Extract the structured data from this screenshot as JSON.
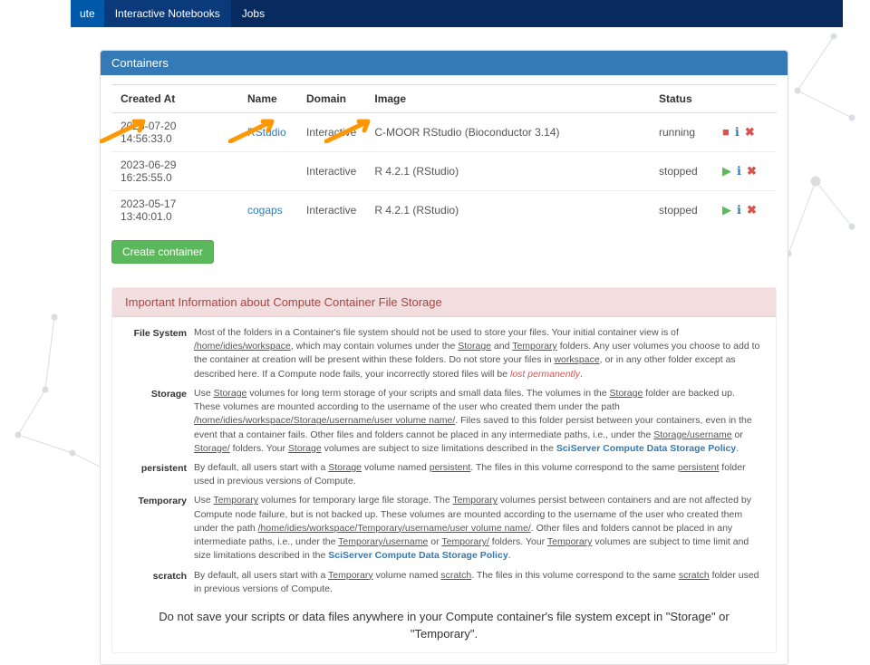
{
  "nav": {
    "brand": "ute",
    "items": [
      "Interactive Notebooks",
      "Jobs"
    ]
  },
  "panel": {
    "title": "Containers",
    "columns": [
      "Created At",
      "Name",
      "Domain",
      "Image",
      "Status",
      ""
    ],
    "rows": [
      {
        "created": "2023-07-20 14:56:33.0",
        "name": "RStudio",
        "domain": "Interactive",
        "image": "C-MOOR RStudio (Bioconductor 3.14)",
        "status": "running",
        "running": true
      },
      {
        "created": "2023-06-29 16:25:55.0",
        "name": "<None>",
        "domain": "Interactive",
        "image": "R 4.2.1 (RStudio)",
        "status": "stopped",
        "running": false
      },
      {
        "created": "2023-05-17 13:40:01.0",
        "name": "cogaps",
        "domain": "Interactive",
        "image": "R 4.2.1 (RStudio)",
        "status": "stopped",
        "running": false
      }
    ],
    "create_label": "Create container"
  },
  "info": {
    "heading": "Important Information about Compute Container File Storage",
    "filesystem_label": "File System",
    "filesystem_text_a": "Most of the folders in a Container's file system should not be used to store your files. Your initial container view is of ",
    "filesystem_path1": "/home/idies/workspace",
    "filesystem_text_b": ", which may contain volumes under the ",
    "filesystem_u1": "Storage",
    "filesystem_text_c": " and ",
    "filesystem_u2": "Temporary",
    "filesystem_text_d": " folders. Any user volumes you choose to add to the container at creation will be present within these folders. Do not store your files in ",
    "filesystem_u3": "workspace",
    "filesystem_text_e": ", or in any other folder except as described here. If a Compute node fails, your incorrectly stored files will be ",
    "filesystem_warn": "lost permanently",
    "storage_label": "Storage",
    "storage_text_a": "Use ",
    "storage_u1": "Storage",
    "storage_text_b": " volumes for long term storage of your scripts and small data files. The volumes in the ",
    "storage_u2": "Storage",
    "storage_text_c": " folder are backed up. These volumes are mounted according to the username of the user who created them under the path ",
    "storage_path": "/home/idies/workspace/Storage/username/user volume name/",
    "storage_text_d": ". Files saved to this folder persist between your containers, even in the event that a container fails. Other files and folders cannot be placed in any intermediate paths, i.e., under the ",
    "storage_u3": "Storage/username",
    "storage_text_e": " or ",
    "storage_u4": "Storage/",
    "storage_text_f": " folders. Your ",
    "storage_u5": "Storage",
    "storage_text_g": " volumes are subject to size limitations described in the ",
    "storage_link": "SciServer Compute Data Storage Policy",
    "persistent_label": "persistent",
    "persistent_text_a": "By default, all users start with a ",
    "persistent_u1": "Storage",
    "persistent_text_b": " volume named ",
    "persistent_u2": "persistent",
    "persistent_text_c": ". The files in this volume correspond to the same ",
    "persistent_u3": "persistent",
    "persistent_text_d": " folder used in previous versions of Compute.",
    "temporary_label": "Temporary",
    "temporary_text_a": "Use ",
    "temporary_u1": "Temporary",
    "temporary_text_b": " volumes for temporary large file storage. The ",
    "temporary_u2": "Temporary",
    "temporary_text_c": " volumes persist between containers and are not affected by Compute node failure, but is not backed up. These volumes are mounted according to the username of the user who created them under the path ",
    "temporary_path": "/home/idies/workspace/Temporary/username/user volume name/",
    "temporary_text_d": ".  Other files and folders cannot be placed in any intermediate paths, i.e., under the ",
    "temporary_u3": "Temporary/username",
    "temporary_text_e": " or ",
    "temporary_u4": "Temporary/",
    "temporary_text_f": " folders. Your ",
    "temporary_u5": "Temporary",
    "temporary_text_g": " volumes are subject to time limit and size limitations described in the ",
    "temporary_link": "SciServer Compute Data Storage Policy",
    "scratch_label": "scratch",
    "scratch_text_a": "By default, all users start with a ",
    "scratch_u1": "Temporary",
    "scratch_text_b": " volume named ",
    "scratch_u2": "scratch",
    "scratch_text_c": ". The files in this volume correspond to the same ",
    "scratch_u3": "scratch",
    "scratch_text_d": " folder used in previous versions of Compute.",
    "footnote": "Do not save your scripts or data files anywhere in your Compute container's file system except in \"Storage\" or \"Temporary\"."
  }
}
